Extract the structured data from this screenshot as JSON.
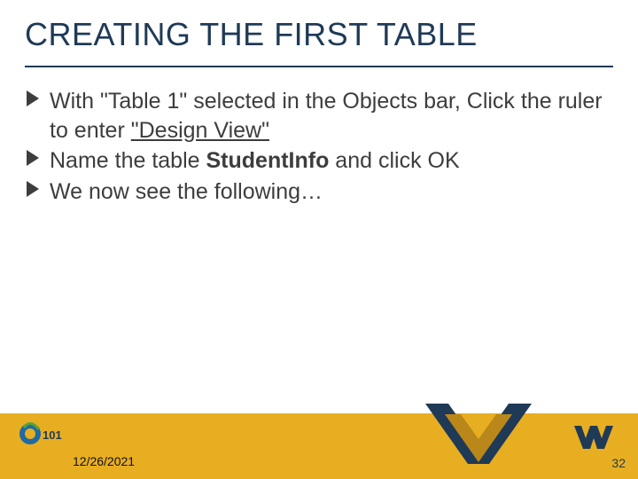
{
  "title": "CREATING THE FIRST TABLE",
  "bullets": [
    {
      "pre": "With \"Table 1\" selected in the Objects bar, Click the ruler to enter ",
      "emph": "\"Design View\"",
      "emph_style": "underline",
      "post": ""
    },
    {
      "pre": "Name the table ",
      "emph": "StudentInfo",
      "emph_style": "bold",
      "post": " and click OK"
    },
    {
      "pre": "We now see the following…",
      "emph": "",
      "emph_style": "",
      "post": ""
    }
  ],
  "footer": {
    "date": "12/26/2021",
    "page_number": "32"
  },
  "colors": {
    "title": "#1f3a56",
    "band": "#e8ae21",
    "chevron_blue": "#1f3a56",
    "chevron_gold": "#b9871a"
  },
  "icons": {
    "bullet_arrow": "chevron-right-filled-icon",
    "course_logo": "course-101-logo-icon",
    "wvu_logo": "wvu-flying-wv-icon"
  }
}
